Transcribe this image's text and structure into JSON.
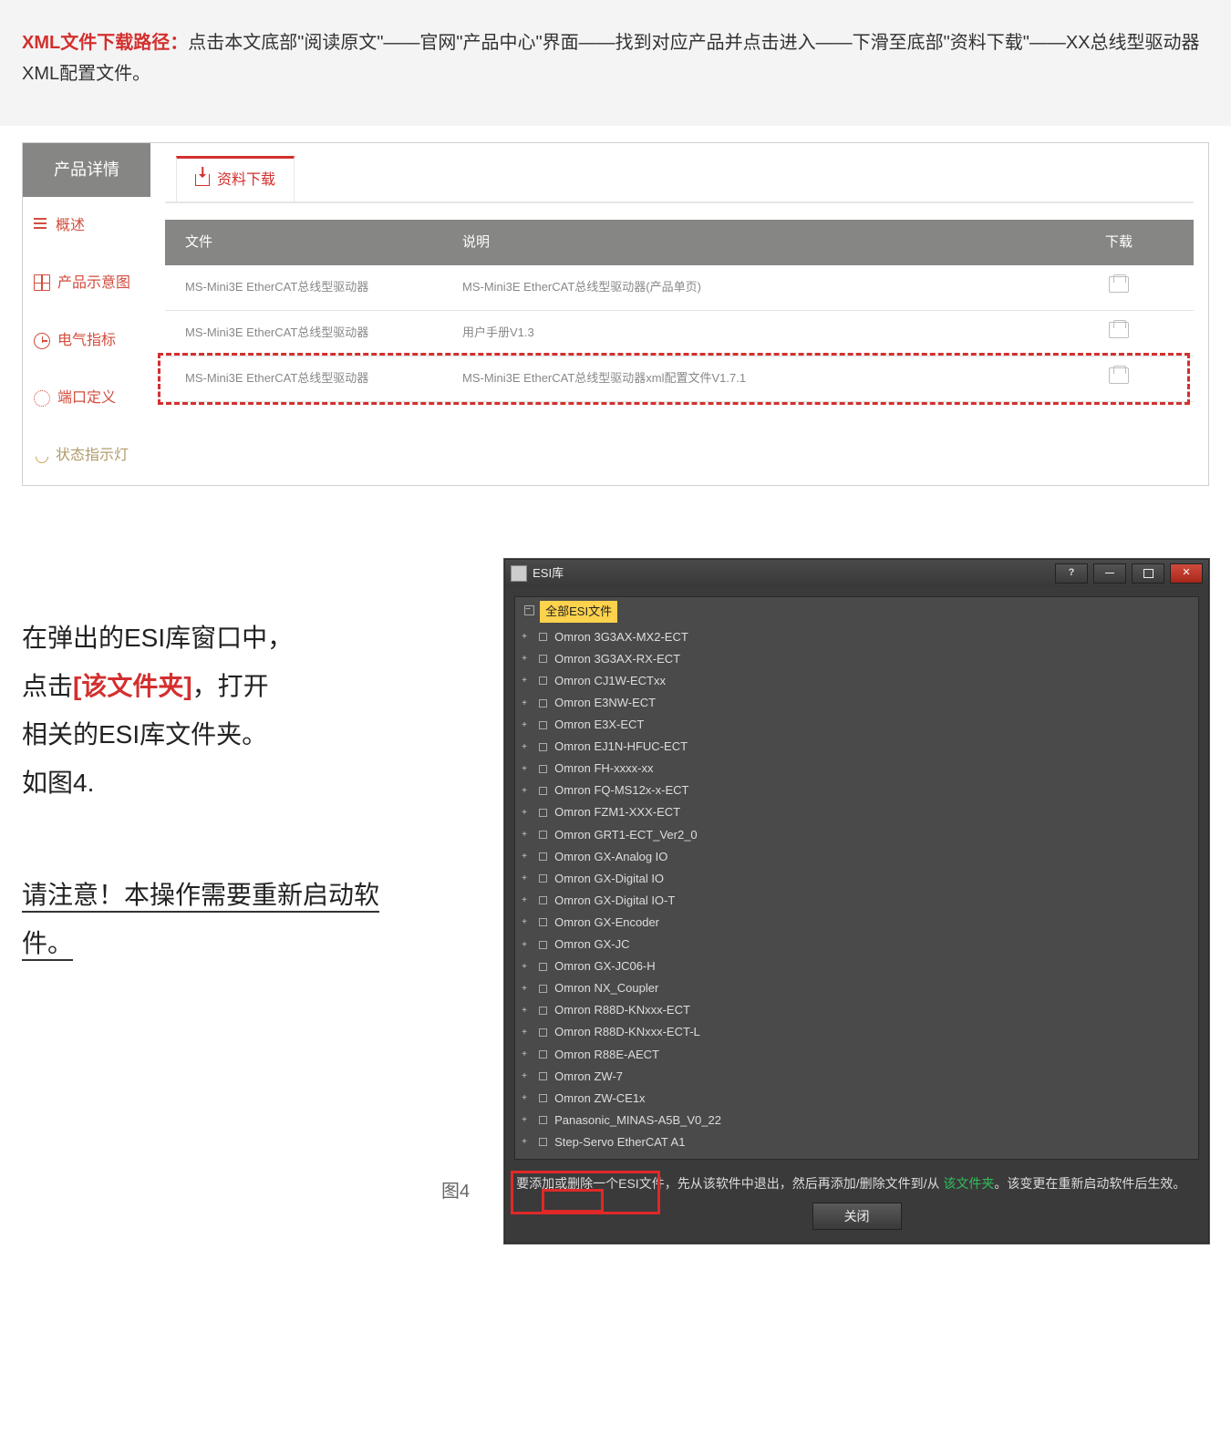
{
  "intro": {
    "prefix": "XML文件下载路径：",
    "body": "点击本文底部\"阅读原文\"——官网\"产品中心\"界面——找到对应产品并点击进入——下滑至底部\"资料下载\"——XX总线型驱动器XML配置文件。"
  },
  "sidebar": {
    "header": "产品详情",
    "items": [
      "概述",
      "产品示意图",
      "电气指标",
      "端口定义",
      "状态指示灯"
    ]
  },
  "downloads": {
    "tab": "资料下载",
    "columns": {
      "file": "文件",
      "desc": "说明",
      "dl": "下载"
    },
    "rows": [
      {
        "file": "MS-Mini3E EtherCAT总线型驱动器",
        "desc": "MS-Mini3E EtherCAT总线型驱动器(产品单页)",
        "highlight": false
      },
      {
        "file": "MS-Mini3E EtherCAT总线型驱动器",
        "desc": "用户手册V1.3",
        "highlight": false
      },
      {
        "file": "MS-Mini3E EtherCAT总线型驱动器",
        "desc": "MS-Mini3E EtherCAT总线型驱动器xml配置文件V1.7.1",
        "highlight": true
      }
    ]
  },
  "step": {
    "l1": "在弹出的ESI库窗口中，",
    "l2a": "点击",
    "l2b": "[该文件夹]",
    "l2c": "，打开",
    "l3": "相关的ESI库文件夹。",
    "l4": "如图4.",
    "warn": "请注意！本操作需要重新启动软件。"
  },
  "figure_label": "图4",
  "window": {
    "title": "ESI库",
    "tree_root": "全部ESI文件",
    "items": [
      "Omron 3G3AX-MX2-ECT",
      "Omron 3G3AX-RX-ECT",
      "Omron CJ1W-ECTxx",
      "Omron E3NW-ECT",
      "Omron E3X-ECT",
      "Omron EJ1N-HFUC-ECT",
      "Omron FH-xxxx-xx",
      "Omron FQ-MS12x-x-ECT",
      "Omron FZM1-XXX-ECT",
      "Omron GRT1-ECT_Ver2_0",
      "Omron GX-Analog IO",
      "Omron GX-Digital IO",
      "Omron GX-Digital IO-T",
      "Omron GX-Encoder",
      "Omron GX-JC",
      "Omron GX-JC06-H",
      "Omron NX_Coupler",
      "Omron R88D-KNxxx-ECT",
      "Omron R88D-KNxxx-ECT-L",
      "Omron R88E-AECT",
      "Omron ZW-7",
      "Omron ZW-CE1x",
      "Panasonic_MINAS-A5B_V0_22",
      "Step-Servo EtherCAT A1"
    ],
    "hint_a": "要添加或删除一个ESI文",
    "hint_b": "件，先从该软件中退出，然后再添加/删除文件到/从 ",
    "hint_link": "该文件夹",
    "hint_c": "。该变更",
    "hint_d": "在重新启动软件后生效。",
    "close": "关闭"
  }
}
